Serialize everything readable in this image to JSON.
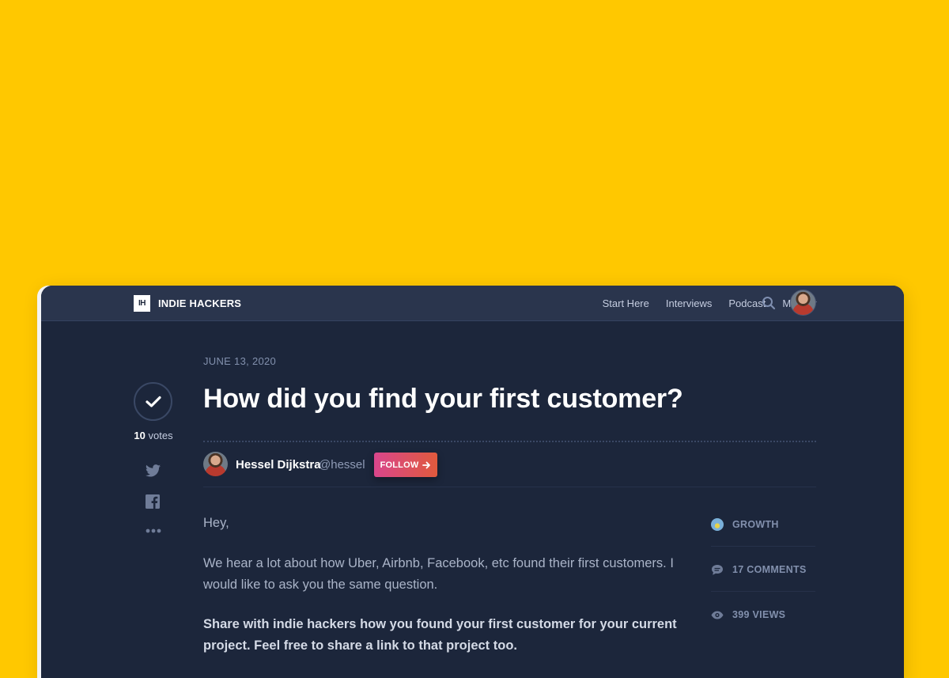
{
  "nav": {
    "logo_mark": "IH",
    "logo_text": "INDIE HACKERS",
    "links": [
      "Start Here",
      "Interviews",
      "Podcast",
      "More"
    ]
  },
  "post": {
    "date": "JUNE 13, 2020",
    "title": "How did you find your first customer?",
    "votes_count": "10",
    "votes_label": "votes",
    "author_name": "Hessel Dijkstra",
    "author_handle": "@hessel",
    "follow_label": "FOLLOW",
    "greeting": "Hey,",
    "paragraph1": "We hear a lot about how Uber, Airbnb, Facebook, etc found their first customers. I would like to ask you the same question.",
    "paragraph2": "Share with indie hackers how you found your first customer for your current project. Feel free to share a link to that project too."
  },
  "sidebar": {
    "group": "GROWTH",
    "comments": "17 COMMENTS",
    "views": "399 VIEWS"
  },
  "icons": {
    "vote": "check-icon",
    "share": [
      "twitter-icon",
      "facebook-icon",
      "more-dots-icon"
    ],
    "search": "search-icon"
  },
  "colors": {
    "background": "#FFC800",
    "window": "#1c263b",
    "navbar": "#2a354d",
    "follow_gradient_start": "#d9468c",
    "follow_gradient_end": "#e05a3d"
  }
}
